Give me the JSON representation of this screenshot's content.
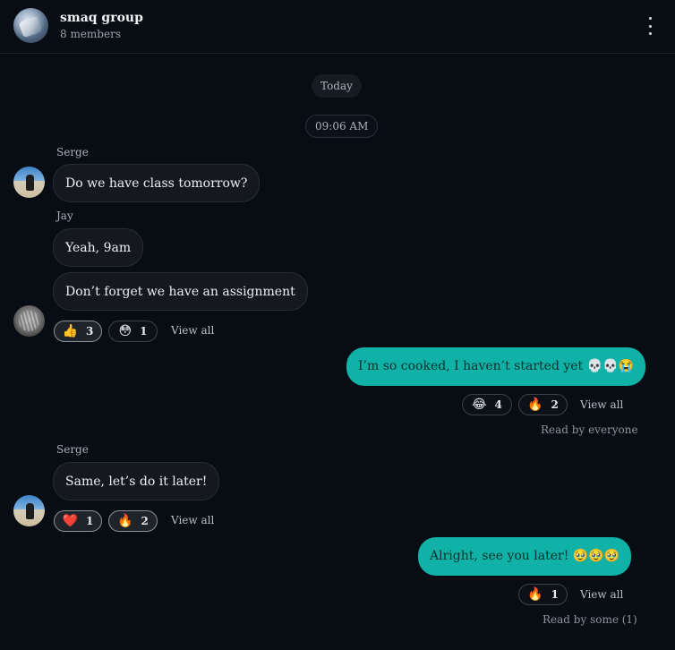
{
  "header": {
    "group_name": "smaq group",
    "members": "8 members",
    "menu_icon": "kebab-menu-icon"
  },
  "date_separator": "Today",
  "time_separator": "09:06 AM",
  "messages": [
    {
      "sender": "Serge",
      "text": "Do we have class tomorrow?"
    },
    {
      "sender": "Jay",
      "text": "Yeah, 9am"
    },
    {
      "sender": "",
      "text": "Don’t forget we have an assignment",
      "reactions": [
        {
          "emoji": "👍",
          "count": "3"
        },
        {
          "emoji": "😳",
          "count": "1"
        }
      ],
      "view_all": "View all"
    },
    {
      "sender": "me",
      "text": "I’m so cooked, I haven’t started yet 💀💀😭",
      "reactions": [
        {
          "emoji": "😂",
          "count": "4"
        },
        {
          "emoji": "🔥",
          "count": "2"
        }
      ],
      "view_all": "View all",
      "read_status": "Read by everyone"
    },
    {
      "sender": "Serge",
      "text": "Same, let’s do it later!",
      "reactions": [
        {
          "emoji": "❤️",
          "count": "1"
        },
        {
          "emoji": "🔥",
          "count": "2"
        }
      ],
      "view_all": "View all"
    },
    {
      "sender": "me",
      "text": "Alright, see you later! 🥹🥹🥹",
      "reactions": [
        {
          "emoji": "🔥",
          "count": "1"
        }
      ],
      "view_all": "View all",
      "read_status": "Read by some (1)"
    }
  ],
  "colors": {
    "background": "#080d14",
    "incoming_bubble": "#15191f",
    "outgoing_bubble": "#10b1a6"
  }
}
